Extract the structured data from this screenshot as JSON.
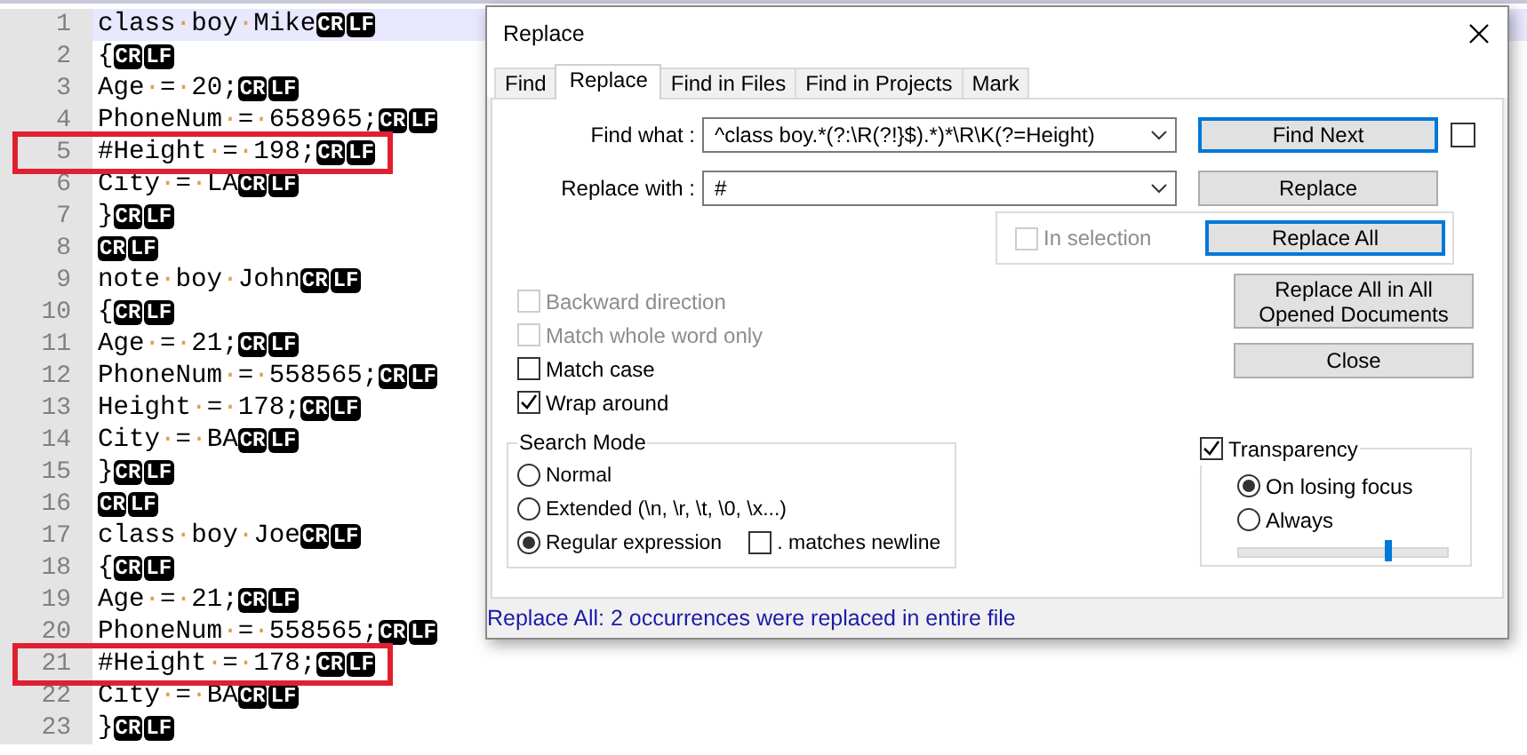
{
  "editor": {
    "lines": [
      {
        "number": "1",
        "text": "class·boy·Mike",
        "eol": [
          "CR",
          "LF"
        ],
        "current": true,
        "marked": false
      },
      {
        "number": "2",
        "text": "{",
        "eol": [
          "CR",
          "LF"
        ],
        "current": false,
        "marked": false
      },
      {
        "number": "3",
        "text": "Age·=·20;",
        "eol": [
          "CR",
          "LF"
        ],
        "current": false,
        "marked": false
      },
      {
        "number": "4",
        "text": "PhoneNum·=·658965;",
        "eol": [
          "CR",
          "LF"
        ],
        "current": false,
        "marked": false
      },
      {
        "number": "5",
        "text": "#Height·=·198;",
        "eol": [
          "CR",
          "LF"
        ],
        "current": false,
        "marked": true
      },
      {
        "number": "6",
        "text": "City·=·LA",
        "eol": [
          "CR",
          "LF"
        ],
        "current": false,
        "marked": false
      },
      {
        "number": "7",
        "text": "}",
        "eol": [
          "CR",
          "LF"
        ],
        "current": false,
        "marked": false
      },
      {
        "number": "8",
        "eol": [
          "CR",
          "LF"
        ],
        "current": false,
        "marked": false
      },
      {
        "number": "9",
        "text": "note·boy·John",
        "eol": [
          "CR",
          "LF"
        ],
        "current": false,
        "marked": false
      },
      {
        "number": "10",
        "text": "{",
        "eol": [
          "CR",
          "LF"
        ],
        "current": false,
        "marked": false
      },
      {
        "number": "11",
        "text": "Age·=·21;",
        "eol": [
          "CR",
          "LF"
        ],
        "current": false,
        "marked": false
      },
      {
        "number": "12",
        "text": "PhoneNum·=·558565;",
        "eol": [
          "CR",
          "LF"
        ],
        "current": false,
        "marked": false
      },
      {
        "number": "13",
        "text": "Height·=·178;",
        "eol": [
          "CR",
          "LF"
        ],
        "current": false,
        "marked": false
      },
      {
        "number": "14",
        "text": "City·=·BA",
        "eol": [
          "CR",
          "LF"
        ],
        "current": false,
        "marked": false
      },
      {
        "number": "15",
        "text": "}",
        "eol": [
          "CR",
          "LF"
        ],
        "current": false,
        "marked": false
      },
      {
        "number": "16",
        "eol": [
          "CR",
          "LF"
        ],
        "current": false,
        "marked": false
      },
      {
        "number": "17",
        "text": "class·boy·Joe",
        "eol": [
          "CR",
          "LF"
        ],
        "current": false,
        "marked": false
      },
      {
        "number": "18",
        "text": "{",
        "eol": [
          "CR",
          "LF"
        ],
        "current": false,
        "marked": false
      },
      {
        "number": "19",
        "text": "Age·=·21;",
        "eol": [
          "CR",
          "LF"
        ],
        "current": false,
        "marked": false
      },
      {
        "number": "20",
        "text": "PhoneNum·=·558565;",
        "eol": [
          "CR",
          "LF"
        ],
        "current": false,
        "marked": false
      },
      {
        "number": "21",
        "text": "#Height·=·178;",
        "eol": [
          "CR",
          "LF"
        ],
        "current": false,
        "marked": true
      },
      {
        "number": "22",
        "text": "City·=·BA",
        "eol": [
          "CR",
          "LF"
        ],
        "current": false,
        "marked": false
      },
      {
        "number": "23",
        "text": "}",
        "eol": [
          "CR",
          "LF"
        ],
        "current": false,
        "marked": false
      }
    ]
  },
  "dialog": {
    "title": "Replace",
    "tabs": [
      {
        "label": "Find",
        "selected": false
      },
      {
        "label": "Replace",
        "selected": true
      },
      {
        "label": "Find in Files",
        "selected": false
      },
      {
        "label": "Find in Projects",
        "selected": false
      },
      {
        "label": "Mark",
        "selected": false
      }
    ],
    "find_what": {
      "label": "Find what :",
      "value": "^class boy.*(?:\\R(?!}$).*)*\\R\\K(?=Height)"
    },
    "replace_with": {
      "label": "Replace with :",
      "value": "#"
    },
    "find_next": {
      "label": "Find Next",
      "focused": true
    },
    "side_checkbox": {
      "checked": false
    },
    "replace": {
      "label": "Replace",
      "focused": false
    },
    "in_selection": {
      "label": "In selection",
      "checked": false,
      "disabled": true
    },
    "replace_all": {
      "label": "Replace All",
      "focused": true
    },
    "replace_all_opened": {
      "label": "Replace All in All Opened Documents",
      "focused": false
    },
    "close_button": {
      "label": "Close",
      "focused": false
    },
    "options": [
      {
        "label": "Backward direction",
        "checked": false,
        "disabled": true
      },
      {
        "label": "Match whole word only",
        "checked": false,
        "disabled": true
      },
      {
        "label": "Match case",
        "checked": false,
        "disabled": false
      },
      {
        "label": "Wrap around",
        "checked": true,
        "disabled": false
      }
    ],
    "search_mode": {
      "title": "Search Mode",
      "modes": [
        {
          "label": "Normal",
          "selected": false
        },
        {
          "label": "Extended (\\n, \\r, \\t, \\0, \\x...)",
          "selected": false
        },
        {
          "label": "Regular expression",
          "selected": true
        }
      ],
      "dot_newline": {
        "label": ". matches newline",
        "checked": false
      }
    },
    "transparency": {
      "label": "Transparency",
      "checked": true,
      "modes": [
        {
          "label": "On losing focus",
          "selected": true
        },
        {
          "label": "Always",
          "selected": false
        }
      ],
      "level": 0.72
    },
    "status": "Replace All: 2 occurrences were replaced in entire file"
  }
}
